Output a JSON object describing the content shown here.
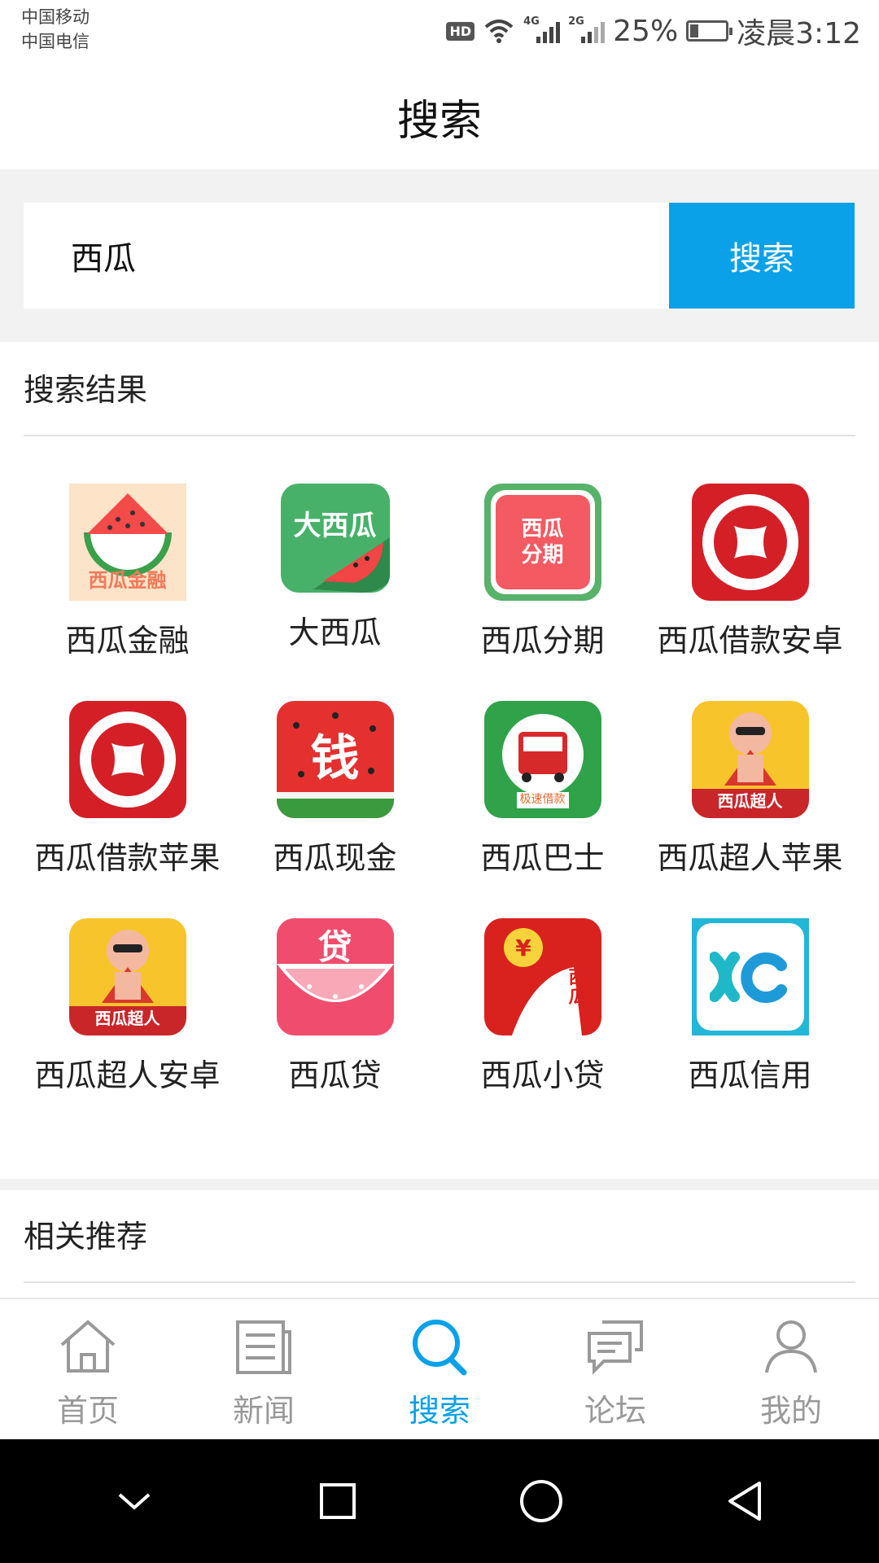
{
  "status_bar": {
    "carrier_1": "中国移动",
    "carrier_2": "中国电信",
    "hd": "HD",
    "net_1": "4G",
    "net_2": "2G",
    "battery": "25%",
    "battery_level": 0.25,
    "time": "凌晨3:12"
  },
  "header": {
    "title": "搜索"
  },
  "search": {
    "value": "西瓜",
    "button_label": "搜索"
  },
  "results": {
    "title": "搜索结果",
    "apps": [
      {
        "name": "西瓜金融",
        "icon": "watermelon-slice-icon",
        "icon_text": "西瓜金融"
      },
      {
        "name": "大西瓜",
        "icon": "watermelon-green-icon",
        "icon_text": "大西瓜"
      },
      {
        "name": "西瓜分期",
        "icon": "watermelon-pattern-icon",
        "icon_text": "西瓜分期"
      },
      {
        "name": "西瓜借款安卓",
        "icon": "coin-red-icon",
        "icon_text": ""
      },
      {
        "name": "西瓜借款苹果",
        "icon": "coin-red-icon",
        "icon_text": ""
      },
      {
        "name": "西瓜现金",
        "icon": "watermelon-money-icon",
        "icon_text": "钱"
      },
      {
        "name": "西瓜巴士",
        "icon": "bus-icon",
        "icon_text": "极速借款"
      },
      {
        "name": "西瓜超人苹果",
        "icon": "pig-superhero-icon",
        "icon_text": "西瓜超人"
      },
      {
        "name": "西瓜超人安卓",
        "icon": "pig-superhero-icon",
        "icon_text": "西瓜超人"
      },
      {
        "name": "西瓜贷",
        "icon": "watermelon-loan-icon",
        "icon_text": "贷"
      },
      {
        "name": "西瓜小贷",
        "icon": "zipper-money-icon",
        "icon_text": "西瓜"
      },
      {
        "name": "西瓜信用",
        "icon": "xc-logo-icon",
        "icon_text": ""
      }
    ]
  },
  "recommend": {
    "title": "相关推荐"
  },
  "bottom_nav": [
    {
      "label": "首页",
      "icon": "home-icon",
      "active": false
    },
    {
      "label": "新闻",
      "icon": "news-icon",
      "active": false
    },
    {
      "label": "搜索",
      "icon": "search-icon",
      "active": true
    },
    {
      "label": "论坛",
      "icon": "forum-icon",
      "active": false
    },
    {
      "label": "我的",
      "icon": "profile-icon",
      "active": false
    }
  ],
  "colors": {
    "accent": "#0aa1e8",
    "background_band": "#f2f2f2",
    "nav_inactive": "#999999"
  }
}
